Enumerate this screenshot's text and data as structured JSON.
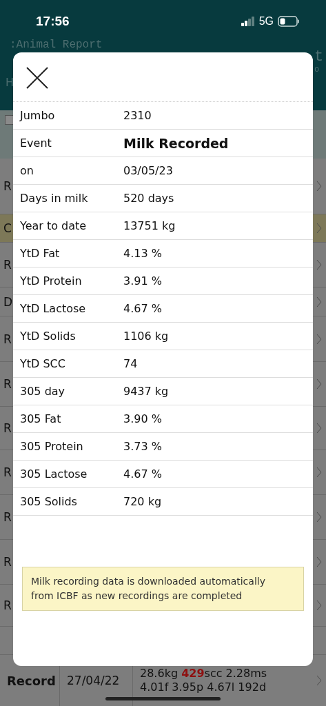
{
  "status_bar": {
    "time": "17:56",
    "network": "5G"
  },
  "header": {
    "title": ":Animal Report",
    "fragments": [
      "t",
      "o"
    ],
    "side_letter": "H"
  },
  "background_rows": [
    {
      "label": "R",
      "selected": false
    },
    {
      "label": "C",
      "selected": true
    },
    {
      "label": "R",
      "selected": false
    },
    {
      "label": "D",
      "selected": false
    },
    {
      "label": "R",
      "selected": false
    },
    {
      "label": "R",
      "selected": false
    },
    {
      "label": "R",
      "selected": false
    },
    {
      "label": "R",
      "selected": false
    },
    {
      "label": "R",
      "selected": false
    },
    {
      "label": "R",
      "selected": false
    },
    {
      "label": "R",
      "selected": false
    }
  ],
  "bottom_row": {
    "label": "Record",
    "date": "27/04/22",
    "line_1": [
      {
        "text": "28.6kg ",
        "alert": false
      },
      {
        "text": "429",
        "alert": true
      },
      {
        "text": "scc 2.28ms",
        "alert": false
      }
    ],
    "line_2": "4.01f 3.95p 4.67l 192d"
  },
  "dialog": {
    "rows": [
      {
        "label": "Jumbo",
        "value": "2310",
        "kind": "plain"
      },
      {
        "label": "Event",
        "value": "Milk Recorded",
        "kind": "heading"
      },
      {
        "label": "on",
        "value": "03/05/23",
        "kind": "plain"
      },
      {
        "label": "Days in milk",
        "value": "520 days",
        "kind": "plain"
      },
      {
        "label": "Year to date",
        "value": "13751 kg",
        "kind": "plain"
      },
      {
        "label": "YtD Fat",
        "value": "4.13 %",
        "kind": "plain"
      },
      {
        "label": "YtD Protein",
        "value": "3.91 %",
        "kind": "plain"
      },
      {
        "label": "YtD Lactose",
        "value": "4.67 %",
        "kind": "plain"
      },
      {
        "label": "YtD Solids",
        "value": "1106 kg",
        "kind": "plain"
      },
      {
        "label": "YtD SCC",
        "value": "74",
        "kind": "plain"
      },
      {
        "label": "305 day",
        "value": "9437 kg",
        "kind": "plain"
      },
      {
        "label": "305 Fat",
        "value": "3.90 %",
        "kind": "plain"
      },
      {
        "label": "305 Protein",
        "value": "3.73 %",
        "kind": "plain"
      },
      {
        "label": "305 Lactose",
        "value": "4.67 %",
        "kind": "plain"
      },
      {
        "label": "305 Solids",
        "value": "720 kg",
        "kind": "plain"
      }
    ],
    "note": "Milk recording data is downloaded automatically from ICBF as new recordings are completed"
  }
}
